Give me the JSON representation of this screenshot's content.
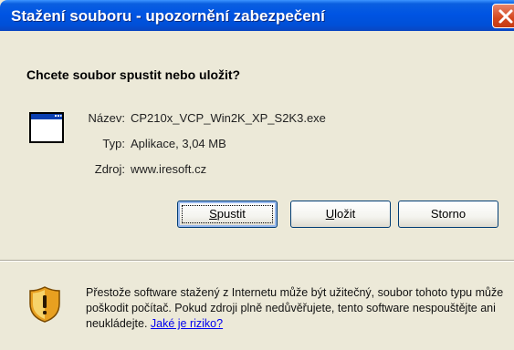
{
  "window": {
    "title": "Stažení souboru - upozornění zabezpečení"
  },
  "dialog": {
    "question": "Chcete soubor spustit nebo uložit?",
    "fields": [
      {
        "label": "Název:",
        "value": "CP210x_VCP_Win2K_XP_S2K3.exe"
      },
      {
        "label": "Typ:",
        "value": "Aplikace, 3,04 MB"
      },
      {
        "label": "Zdroj:",
        "value": "www.iresoft.cz"
      }
    ],
    "buttons": {
      "run": {
        "pre": "",
        "accel": "S",
        "post": "pustit"
      },
      "save": {
        "pre": "",
        "accel": "U",
        "post": "ložit"
      },
      "cancel": "Storno"
    },
    "warning": {
      "text": "Přestože software stažený z Internetu může být užitečný, soubor tohoto typu může poškodit počítač. Pokud zdroji plně nedůvěřujete, tento software nespouštějte ani neukládejte. ",
      "link": "Jaké je riziko?"
    }
  },
  "colors": {
    "titlebar": "#0054e3",
    "background": "#ece9d8",
    "close": "#d4481e",
    "link": "#0000ee"
  },
  "icons": {
    "close": "close-icon",
    "app": "application-window-icon",
    "shield": "security-shield-icon"
  }
}
